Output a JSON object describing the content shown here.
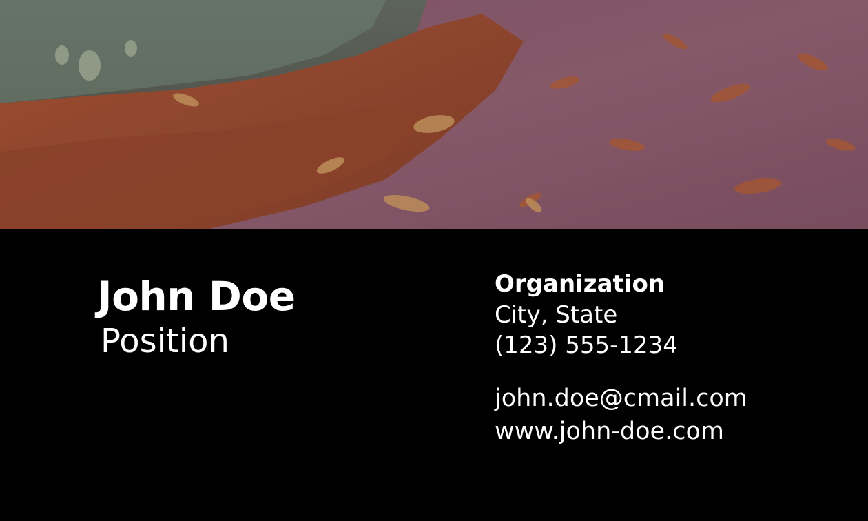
{
  "card": {
    "name": "John Doe",
    "position": "Position",
    "organization": "Organization",
    "location": "City, State",
    "phone": "(123) 555-1234",
    "email": "john.doe@cmail.com",
    "website": "www.john-doe.com"
  },
  "photo": {
    "subject": "autumn leaves on grass and dirt path"
  },
  "colors": {
    "background": "#000000",
    "text": "#ffffff",
    "grass": "#6f8a78",
    "leaves": "#9a4a2a",
    "path": "#8a5a68"
  }
}
